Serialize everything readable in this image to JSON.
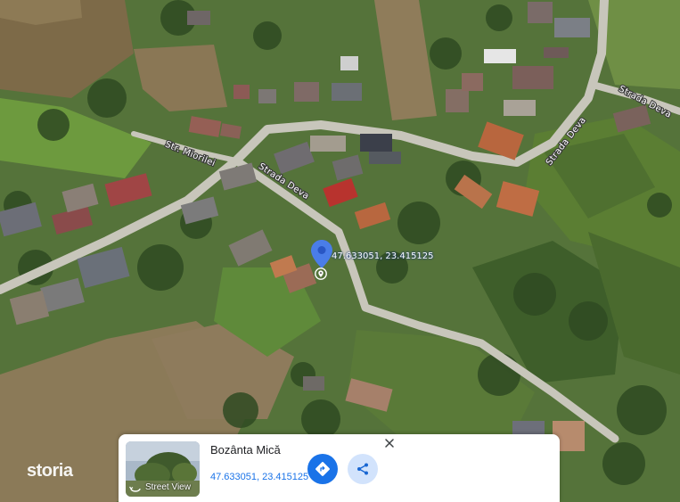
{
  "map": {
    "type": "satellite",
    "road_labels": {
      "miorilei": "Str. Miorilei",
      "deva_left": "Strada Deva",
      "deva_mid": "Strada Deva",
      "deva_right": "Strada Deva"
    },
    "pin_coordinates_label": "47.633051, 23.415125",
    "icons": [
      "location-pin-icon",
      "place-marker-icon"
    ]
  },
  "watermark": "storia",
  "info_card": {
    "place_name": "Bozânta Mică",
    "coordinates": "47.633051, 23.415125",
    "street_view_label": "Street View",
    "icons": [
      "close-icon",
      "directions-icon",
      "share-icon",
      "street-view-icon"
    ],
    "colors": {
      "primary_button": "#1a73e8",
      "secondary_button": "#d2e3fc",
      "link": "#1a73e8"
    }
  }
}
